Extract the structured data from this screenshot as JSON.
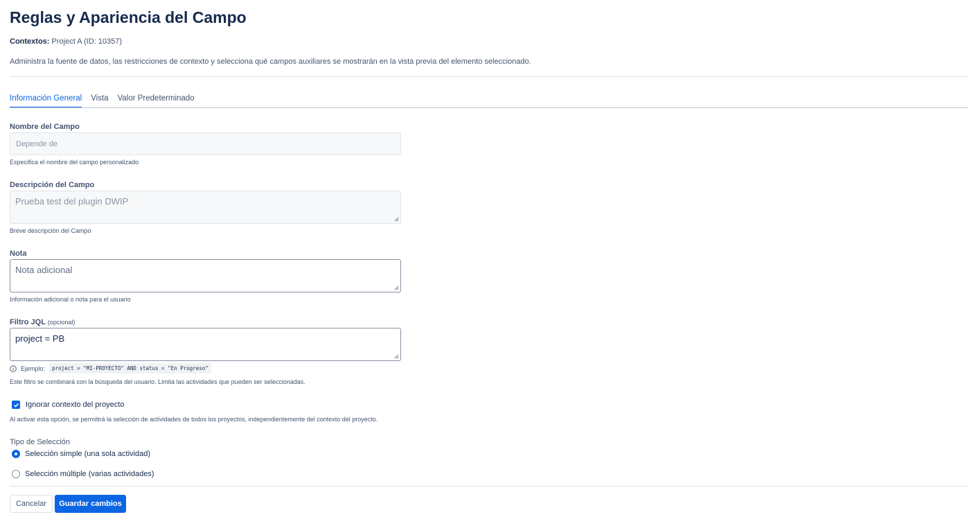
{
  "header": {
    "title": "Reglas y Apariencia del Campo",
    "context_label": "Contextos:",
    "context_value": "Project A (ID: 10357)",
    "description": "Administra la fuente de datos, las restricciones de contexto y selecciona qué campos auxiliares se mostrarán en la vista previa del elemento seleccionado."
  },
  "tabs": [
    {
      "label": "Información General",
      "active": true
    },
    {
      "label": "Vista",
      "active": false
    },
    {
      "label": "Valor Predeterminado",
      "active": false
    }
  ],
  "form": {
    "field_name": {
      "label": "Nombre del Campo",
      "value": "Depende de",
      "help": "Especifica el nombre del campo personalizado"
    },
    "field_description": {
      "label": "Descripción del Campo",
      "value": "Prueba test del plugin DWIP",
      "help": "Breve descripción del Campo"
    },
    "note": {
      "label": "Nota",
      "placeholder": "Nota adicional",
      "help": "Información adicional o nota para el usuario"
    },
    "jql": {
      "label": "Filtro JQL",
      "optional": "(opcional)",
      "value": "project = PB",
      "example_label": "Ejemplo:",
      "example_code": "project = \"MI-PROYECTO\" AND status = \"En Progreso\"",
      "help": "Este filtro se combinará con la búsqueda del usuario. Limita las actividades que pueden ser seleccionadas."
    },
    "ignore_context": {
      "label": "Ignorar contexto del proyecto",
      "checked": true,
      "help": "Al activar esta opción, se permitirá la selección de actividades de todos los proyectos, independientemente del contexto del proyecto."
    },
    "selection_type": {
      "label": "Tipo de Selección",
      "options": [
        {
          "label": "Selección simple (una sola actividad)",
          "selected": true
        },
        {
          "label": "Selección múltiple (varias actividades)",
          "selected": false
        }
      ]
    }
  },
  "footer": {
    "cancel_label": "Cancelar",
    "save_label": "Guardar cambios"
  },
  "colors": {
    "accent": "#0c66e4",
    "text": "#172b4d",
    "subtle_text": "#44546f",
    "border": "#dcdfe4"
  },
  "icons": {
    "example_hint": "info-icon",
    "checkbox_mark": "check-icon",
    "textarea_grip": "resize-handle-icon"
  }
}
